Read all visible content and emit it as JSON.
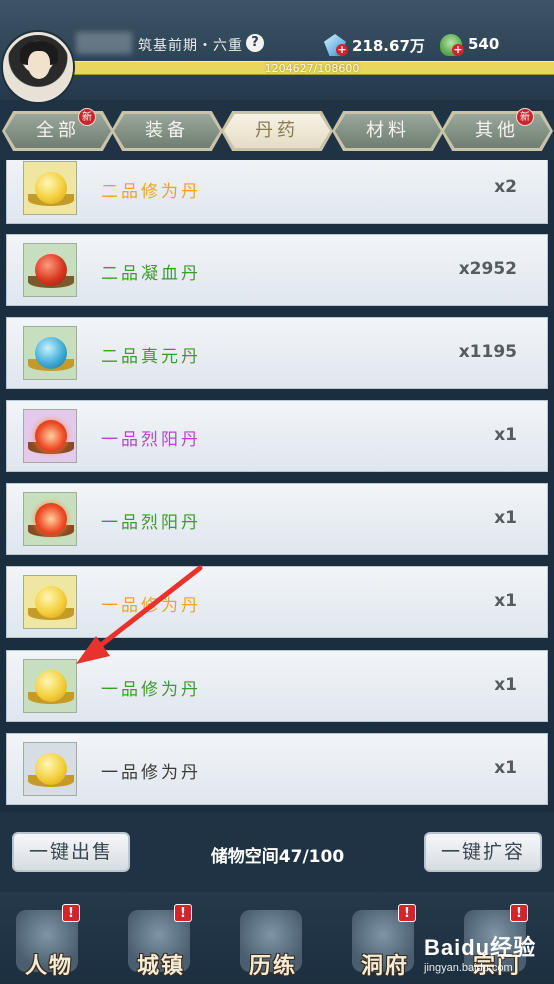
{
  "header": {
    "realm": "筑基前期・六重",
    "help": "?",
    "spirit_stone": "218.67万",
    "jade": "540",
    "plus": "+",
    "exp": "1204627/108600"
  },
  "tabs": [
    {
      "label": "全部",
      "badge": "新"
    },
    {
      "label": "装备",
      "badge": ""
    },
    {
      "label": "丹药",
      "badge": ""
    },
    {
      "label": "材料",
      "badge": ""
    },
    {
      "label": "其他",
      "badge": "新"
    }
  ],
  "items": [
    {
      "name": "二品修为丹",
      "qty": "x2"
    },
    {
      "name": "二品凝血丹",
      "qty": "x2952"
    },
    {
      "name": "二品真元丹",
      "qty": "x1195"
    },
    {
      "name": "一品烈阳丹",
      "qty": "x1"
    },
    {
      "name": "一品烈阳丹",
      "qty": "x1"
    },
    {
      "name": "一品修为丹",
      "qty": "x1"
    },
    {
      "name": "一品修为丹",
      "qty": "x1"
    },
    {
      "name": "一品修为丹",
      "qty": "x1"
    }
  ],
  "bottom": {
    "sell_all": "一键出售",
    "storage": "储物空间47/100",
    "expand": "一键扩容"
  },
  "nav": [
    {
      "label": "人物",
      "alert": "!"
    },
    {
      "label": "城镇",
      "alert": "!"
    },
    {
      "label": "历练",
      "alert": ""
    },
    {
      "label": "洞府",
      "alert": "!"
    },
    {
      "label": "宗门",
      "alert": "!"
    }
  ],
  "watermark": {
    "brand": "Baidu经验",
    "url": "jingyan.baidu.com"
  }
}
